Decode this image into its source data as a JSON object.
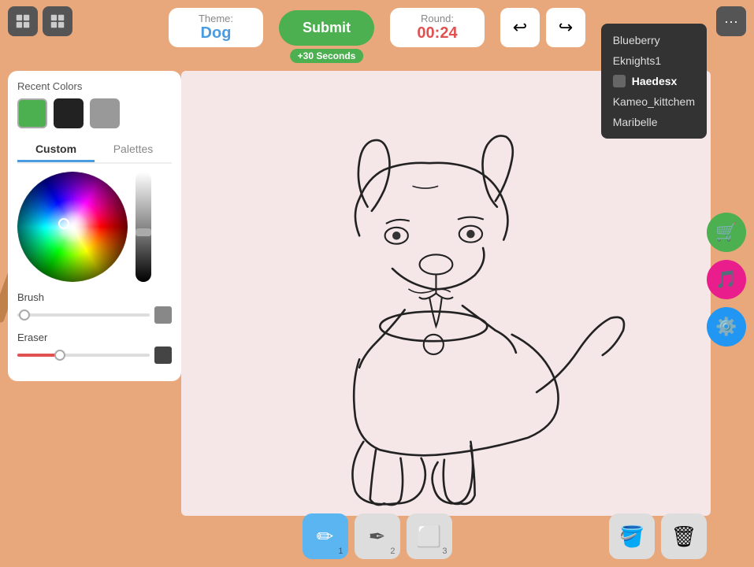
{
  "topBar": {
    "theme_label": "Theme:",
    "theme_value": "Dog",
    "submit_label": "Submit",
    "submit_bonus": "+30 Seconds",
    "round_label": "Round:",
    "round_value": "00:24",
    "undo_label": "↩",
    "redo_label": "↪"
  },
  "players": [
    {
      "name": "Blueberry",
      "active": false
    },
    {
      "name": "Eknights1",
      "active": false
    },
    {
      "name": "Haedesx",
      "active": true
    },
    {
      "name": "Kameo_kittchem",
      "active": false
    },
    {
      "name": "Maribelle",
      "active": false
    }
  ],
  "leftPanel": {
    "recent_colors_label": "Recent Colors",
    "swatches": [
      "#4CAF50",
      "#222222",
      "#999999"
    ],
    "tab_custom": "Custom",
    "tab_palettes": "Palettes",
    "brush_label": "Brush",
    "eraser_label": "Eraser"
  },
  "bottomTools": [
    {
      "id": "brush",
      "label": "✏️",
      "number": "1",
      "active": true
    },
    {
      "id": "pencil",
      "label": "✒️",
      "number": "2",
      "active": false
    },
    {
      "id": "eraser",
      "label": "◻️",
      "number": "3",
      "active": false
    }
  ],
  "actionTools": [
    {
      "id": "fill",
      "label": "🪣"
    },
    {
      "id": "delete",
      "label": "🗑️"
    }
  ],
  "sideIcons": [
    {
      "id": "cart",
      "label": "🛒",
      "color": "green"
    },
    {
      "id": "music",
      "label": "🎵",
      "color": "pink"
    },
    {
      "id": "settings",
      "label": "⚙️",
      "color": "blue"
    }
  ]
}
